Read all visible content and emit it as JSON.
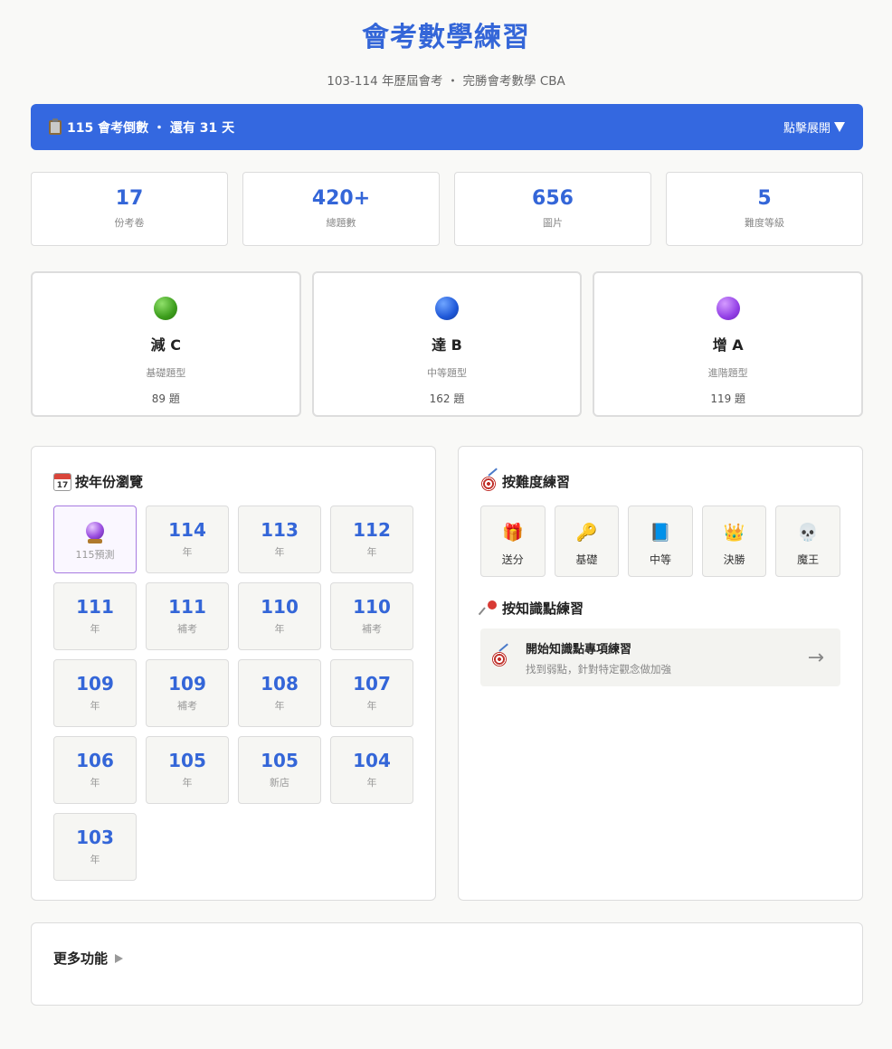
{
  "header": {
    "title": "會考數學練習",
    "subtitle": "103-114 年歷屆會考 ・ 完勝會考數學 CBA"
  },
  "countdown": {
    "text": "115 會考倒數 ・ 還有 31 天",
    "toggle_label": "點擊展開"
  },
  "stats": [
    {
      "value": "17",
      "label": "份考卷"
    },
    {
      "value": "420+",
      "label": "總題數"
    },
    {
      "value": "656",
      "label": "圖片"
    },
    {
      "value": "5",
      "label": "難度等級"
    }
  ],
  "levels": [
    {
      "name": "減 C",
      "desc": "基礎題型",
      "count": "89 題",
      "color": "#3c9d1c"
    },
    {
      "name": "達 B",
      "desc": "中等題型",
      "count": "162 題",
      "color": "#1f58d8"
    },
    {
      "name": "增 A",
      "desc": "進階題型",
      "count": "119 題",
      "color": "#9340e6"
    }
  ],
  "years_panel": {
    "title": "按年份瀏覽",
    "icon_text": "17",
    "predict_label": "115預測",
    "years": [
      {
        "year": "114",
        "sub": "年"
      },
      {
        "year": "113",
        "sub": "年"
      },
      {
        "year": "112",
        "sub": "年"
      },
      {
        "year": "111",
        "sub": "年"
      },
      {
        "year": "111",
        "sub": "補考"
      },
      {
        "year": "110",
        "sub": "年"
      },
      {
        "year": "110",
        "sub": "補考"
      },
      {
        "year": "109",
        "sub": "年"
      },
      {
        "year": "109",
        "sub": "補考"
      },
      {
        "year": "108",
        "sub": "年"
      },
      {
        "year": "107",
        "sub": "年"
      },
      {
        "year": "106",
        "sub": "年"
      },
      {
        "year": "105",
        "sub": "年"
      },
      {
        "year": "105",
        "sub": "新店"
      },
      {
        "year": "104",
        "sub": "年"
      },
      {
        "year": "103",
        "sub": "年"
      }
    ]
  },
  "difficulty_panel": {
    "title": "按難度練習",
    "buttons": [
      {
        "icon": "🎁",
        "label": "送分"
      },
      {
        "icon": "🔑",
        "label": "基礎"
      },
      {
        "icon": "📘",
        "label": "中等"
      },
      {
        "icon": "👑",
        "label": "決勝"
      },
      {
        "icon": "💀",
        "label": "魔王"
      }
    ],
    "knowledge_title": "按知識點練習",
    "knowledge_card": {
      "title": "開始知識點專項練習",
      "subtitle": "找到弱點，針對特定觀念做加強",
      "arrow": "→"
    }
  },
  "more": {
    "title": "更多功能"
  },
  "colors": {
    "accent": "#3466d8",
    "banner": "#3468e0",
    "background": "#f9f9f7"
  }
}
